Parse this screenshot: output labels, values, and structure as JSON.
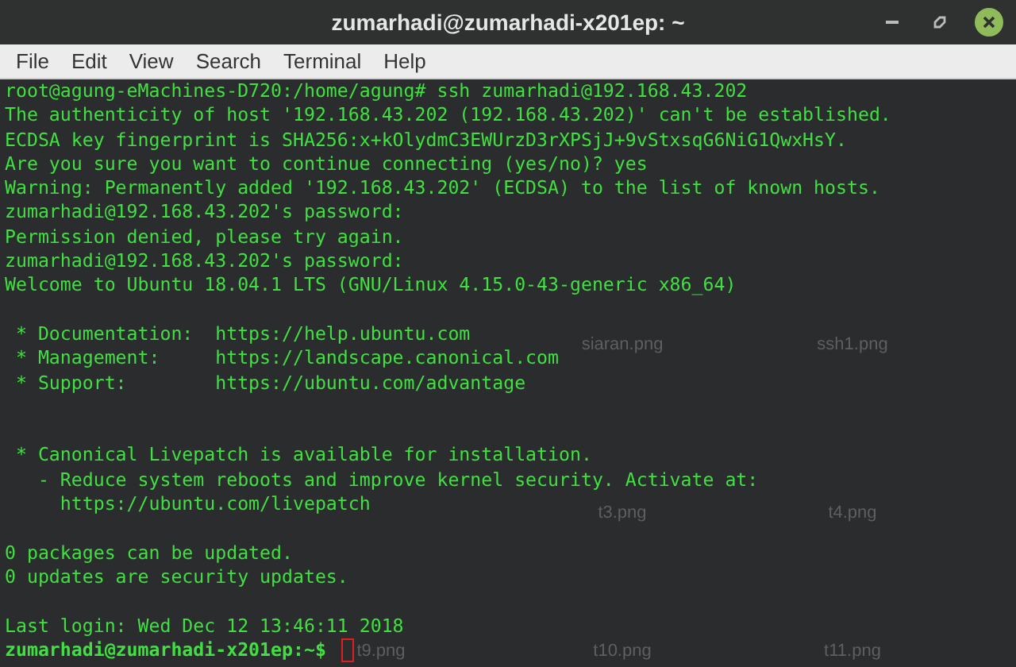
{
  "window": {
    "title": "zumarhadi@zumarhadi-x201ep: ~"
  },
  "menu": [
    "File",
    "Edit",
    "View",
    "Search",
    "Terminal",
    "Help"
  ],
  "desktop_files": [
    {
      "label": "siaran.png"
    },
    {
      "label": "ssh1.png"
    },
    {
      "label": "t3.png"
    },
    {
      "label": "t4.png"
    },
    {
      "label": "t9.png"
    },
    {
      "label": "t10.png"
    },
    {
      "label": "t11.png"
    }
  ],
  "terminal": {
    "lines": [
      {
        "kind": "output",
        "text": "root@agung-eMachines-D720:/home/agung# ssh zumarhadi@192.168.43.202"
      },
      {
        "kind": "output",
        "text": "The authenticity of host '192.168.43.202 (192.168.43.202)' can't be established."
      },
      {
        "kind": "output",
        "text": "ECDSA key fingerprint is SHA256:x+kOlydmC3EWUrzD3rXPSjJ+9vStxsqG6NiG1QwxHsY."
      },
      {
        "kind": "output",
        "text": "Are you sure you want to continue connecting (yes/no)? yes"
      },
      {
        "kind": "output",
        "text": "Warning: Permanently added '192.168.43.202' (ECDSA) to the list of known hosts."
      },
      {
        "kind": "output",
        "text": "zumarhadi@192.168.43.202's password:"
      },
      {
        "kind": "output",
        "text": "Permission denied, please try again."
      },
      {
        "kind": "output",
        "text": "zumarhadi@192.168.43.202's password:"
      },
      {
        "kind": "output",
        "text": "Welcome to Ubuntu 18.04.1 LTS (GNU/Linux 4.15.0-43-generic x86_64)"
      },
      {
        "kind": "blank"
      },
      {
        "kind": "output",
        "text": " * Documentation:  https://help.ubuntu.com"
      },
      {
        "kind": "output",
        "text": " * Management:     https://landscape.canonical.com"
      },
      {
        "kind": "output",
        "text": " * Support:        https://ubuntu.com/advantage"
      },
      {
        "kind": "blank"
      },
      {
        "kind": "blank"
      },
      {
        "kind": "output",
        "text": " * Canonical Livepatch is available for installation."
      },
      {
        "kind": "output",
        "text": "   - Reduce system reboots and improve kernel security. Activate at:"
      },
      {
        "kind": "output",
        "text": "     https://ubuntu.com/livepatch"
      },
      {
        "kind": "blank"
      },
      {
        "kind": "output",
        "text": "0 packages can be updated."
      },
      {
        "kind": "output",
        "text": "0 updates are security updates."
      },
      {
        "kind": "blank"
      },
      {
        "kind": "output",
        "text": "Last login: Wed Dec 12 13:46:11 2018"
      },
      {
        "kind": "prompt",
        "text": "zumarhadi@zumarhadi-x201ep:~$",
        "cursor": true
      }
    ]
  }
}
